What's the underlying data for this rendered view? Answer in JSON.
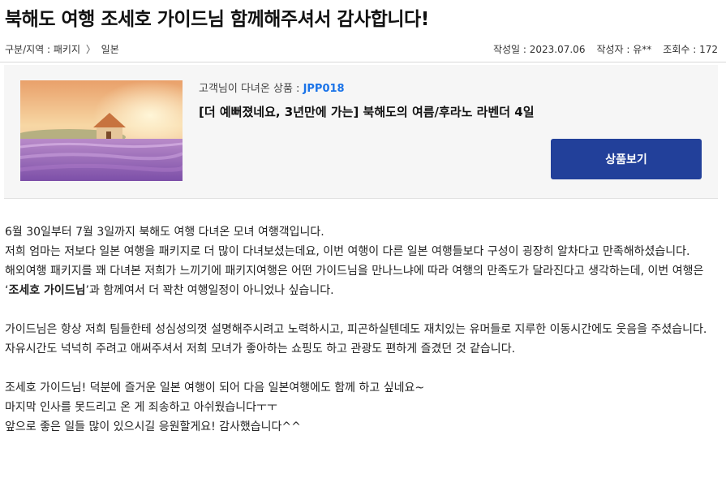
{
  "post": {
    "title": "북해도 여행 조세호 가이드님 함께해주셔서 감사합니다!",
    "category_label": "구분/지역 : 패키지",
    "breadcrumb_sep": "〉",
    "region": "일본",
    "date": "작성일 : 2023.07.06",
    "author": "작성자 : 유**",
    "views": "조회수 : 172"
  },
  "product": {
    "code_prefix": "고객님이 다녀온 상품 : ",
    "code": "JPP018",
    "name": "[더 예뻐졌네요, 3년만에 가는] 북해도의 여름/후라노 라벤더 4일",
    "view_button": "상품보기",
    "image_icon": "lavender-field-photo"
  },
  "body": {
    "p1": "6월 30일부터 7월 3일까지 북해도 여행 다녀온 모녀 여행객입니다.",
    "p2": "저희 엄마는 저보다 일본 여행을 패키지로 더 많이 다녀보셨는데요, 이번 여행이 다른 일본 여행들보다 구성이 굉장히 알차다고 만족해하셨습니다.",
    "p3_before": "해외여행 패키지를 꽤 다녀본 저희가 느끼기에 패키지여행은 어떤 가이드님을 만나느냐에 따라 여행의 만족도가 달라진다고 생각하는데, 이번 여행은 ‘",
    "p3_bold": "조세호 가이드님",
    "p3_after": "’과 함께여서 더 꽉찬 여행일정이 아니었나 싶습니다.",
    "p4": "가이드님은 항상 저희 팀들한테 성심성의껏 설명해주시려고 노력하시고, 피곤하실텐데도 재치있는 유머들로 지루한 이동시간에도 웃음을 주셨습니다.",
    "p5": "자유시간도 넉넉히 주려고 애써주셔서 저희 모녀가 좋아하는 쇼핑도 하고 관광도 편하게 즐겼던 것 같습니다.",
    "p6": "조세호 가이드님! 덕분에 즐거운 일본 여행이 되어 다음 일본여행에도 함께 하고 싶네요~",
    "p7": "마지막 인사를 못드리고 온 게 죄송하고 아쉬웠습니다ㅜㅜ",
    "p8": "앞으로 좋은 일들 많이 있으시길 응원할게요! 감사했습니다^^"
  },
  "colors": {
    "button_bg": "#22409a",
    "code_link": "#1a73e8"
  }
}
